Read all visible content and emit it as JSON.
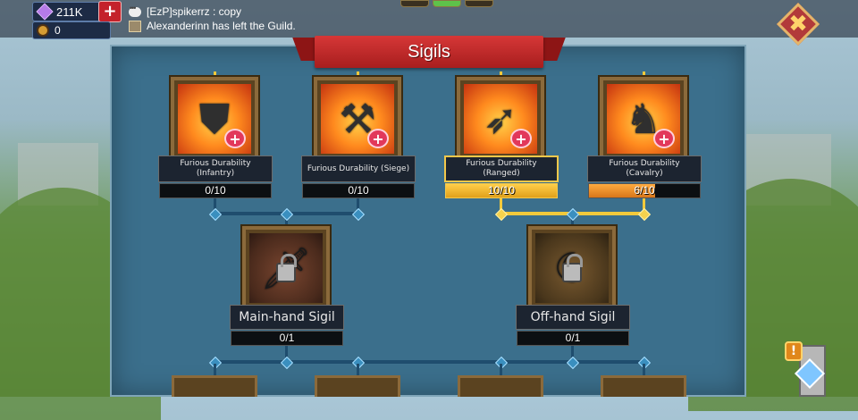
{
  "topbar": {
    "gems": "211K",
    "plus_label": "+",
    "resource": "0",
    "chat": [
      {
        "icon": "speech-bubble-icon",
        "text": "[EzP]spikerrz : copy"
      },
      {
        "icon": "guild-icon",
        "text": "Alexanderinn has left the Guild."
      }
    ],
    "close_label": "✖"
  },
  "panel": {
    "title": "Sigils"
  },
  "sigils": [
    {
      "name": "Furious Durability\n(Infantry)",
      "progress": "0/10",
      "fill": 0,
      "icon": "shield-icon"
    },
    {
      "name": "Furious Durability (Siege)",
      "progress": "0/10",
      "fill": 0,
      "icon": "catapult-icon"
    },
    {
      "name": "Furious Durability\n(Ranged)",
      "progress": "10/10",
      "fill": 1.0,
      "icon": "bow-icon",
      "selected": true
    },
    {
      "name": "Furious Durability\n(Cavalry)",
      "progress": "6/10",
      "fill": 0.6,
      "icon": "horse-icon"
    }
  ],
  "locked_sigils": [
    {
      "name": "Main-hand Sigil",
      "progress": "0/1",
      "icon": "sword-icon",
      "locked": true
    },
    {
      "name": "Off-hand Sigil",
      "progress": "0/1",
      "icon": "offhand-icon",
      "locked": true
    }
  ],
  "colors": {
    "panel": "#3b6f8c",
    "banner": "#c22a2a",
    "progress_gold": "#f3c84b",
    "progress_orange": "#e08a24",
    "connector_active": "#f2c93b",
    "connector_inactive": "#1f4d6e"
  }
}
